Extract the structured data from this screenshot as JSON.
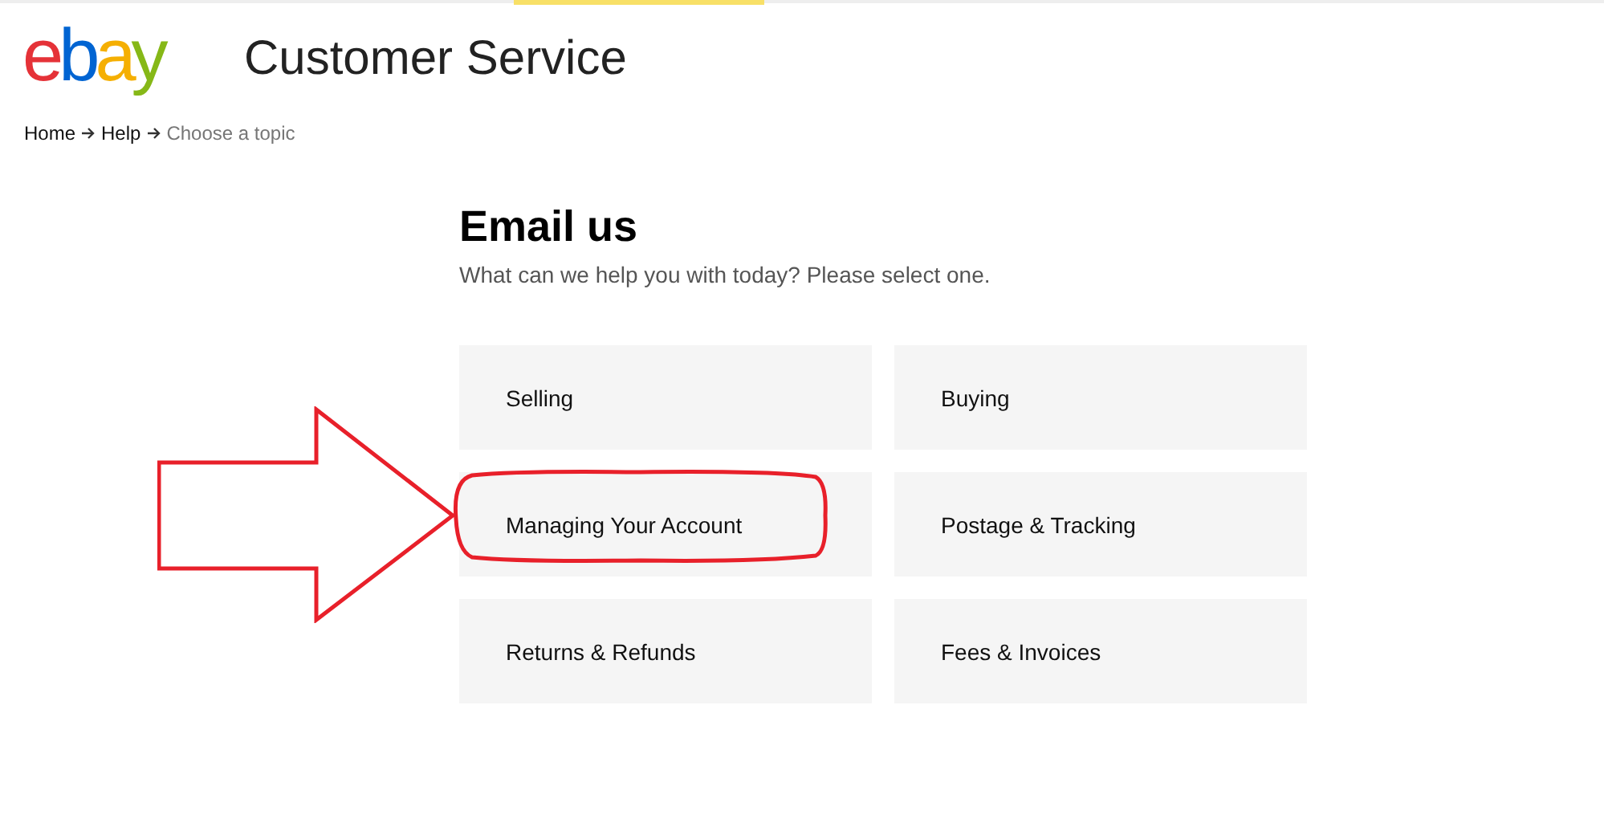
{
  "header": {
    "logo": [
      {
        "text": "e",
        "color": "#e53238"
      },
      {
        "text": "b",
        "color": "#0064d2"
      },
      {
        "text": "a",
        "color": "#f5af02"
      },
      {
        "text": "y",
        "color": "#86b817"
      }
    ],
    "title": "Customer Service"
  },
  "breadcrumb": [
    {
      "label": "Home",
      "current": false
    },
    {
      "label": "Help",
      "current": false
    },
    {
      "label": "Choose a topic",
      "current": true
    }
  ],
  "heading": "Email us",
  "subtitle": "What can we help you with today? Please select one.",
  "topics": [
    {
      "label": "Selling",
      "highlighted": false
    },
    {
      "label": "Buying",
      "highlighted": false
    },
    {
      "label": "Managing Your Account",
      "highlighted": true
    },
    {
      "label": "Postage & Tracking",
      "highlighted": false
    },
    {
      "label": "Returns & Refunds",
      "highlighted": false
    },
    {
      "label": "Fees & Invoices",
      "highlighted": false
    }
  ]
}
